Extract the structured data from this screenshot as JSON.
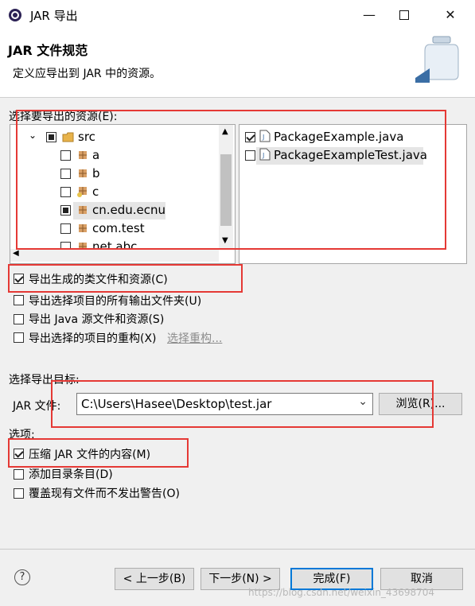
{
  "window": {
    "title": "JAR 导出"
  },
  "header": {
    "title": "JAR 文件规范",
    "desc": "定义应导出到 JAR 中的资源。"
  },
  "resources": {
    "label": "选择要导出的资源(E):",
    "tree": [
      {
        "label": "src",
        "state": "partial",
        "kind": "src"
      },
      {
        "label": "a",
        "state": "unchecked",
        "kind": "pkg"
      },
      {
        "label": "b",
        "state": "unchecked",
        "kind": "pkg"
      },
      {
        "label": "c",
        "state": "unchecked",
        "kind": "pkg-special"
      },
      {
        "label": "cn.edu.ecnu",
        "state": "partial",
        "kind": "pkg",
        "selected": true
      },
      {
        "label": "com.test",
        "state": "unchecked",
        "kind": "pkg"
      },
      {
        "label": "net.abc",
        "state": "unchecked",
        "kind": "pkg"
      }
    ],
    "files": [
      {
        "label": "PackageExample.java",
        "checked": true
      },
      {
        "label": "PackageExampleTest.java",
        "checked": false,
        "selected": true
      }
    ]
  },
  "options_top": [
    {
      "label": "导出生成的类文件和资源(C)",
      "checked": true
    },
    {
      "label": "导出选择项目的所有输出文件夹(U)",
      "checked": false
    },
    {
      "label": "导出 Java 源文件和资源(S)",
      "checked": false
    },
    {
      "label": "导出选择的项目的重构(X)",
      "checked": false,
      "link": "选择重构..."
    }
  ],
  "destination": {
    "label": "选择导出目标:",
    "jar_label": "JAR 文件:",
    "path": "C:\\Users\\Hasee\\Desktop\\test.jar",
    "browse": "浏览(R)..."
  },
  "options": {
    "label": "选项:",
    "items": [
      {
        "label": "压缩 JAR 文件的内容(M)",
        "checked": true
      },
      {
        "label": "添加目录条目(D)",
        "checked": false
      },
      {
        "label": "覆盖现有文件而不发出警告(O)",
        "checked": false
      }
    ]
  },
  "footer": {
    "help": "?",
    "back": "< 上一步(B)",
    "next": "下一步(N) >",
    "finish": "完成(F)",
    "cancel": "取消",
    "watermark": "https://blog.csdn.net/weixin_43698704"
  },
  "colors": {
    "highlight": "#e53935",
    "accent": "#0078d7",
    "selection": "#e5e5e5"
  }
}
